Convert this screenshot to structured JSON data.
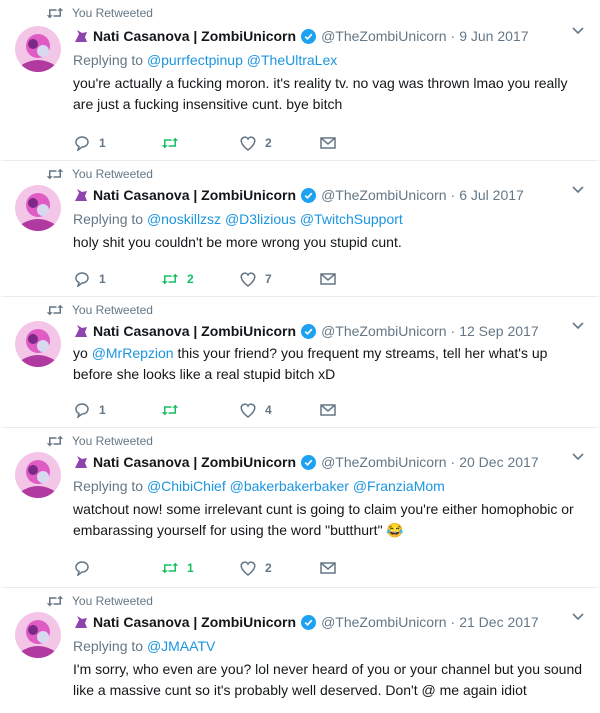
{
  "retweet_label": "You Retweeted",
  "author": {
    "name": "Nati Casanova | ZombiUnicorn",
    "handle": "@TheZombiUnicorn"
  },
  "dot": "·",
  "replying_prefix": "Replying to",
  "colors": {
    "link": "#1b95e0",
    "retweet_green": "#17bf63",
    "muted": "#657786",
    "verified": "#1da1f2"
  },
  "tweets": [
    {
      "date": "9 Jun 2017",
      "reply_to": [
        "@purrfectpinup",
        "@TheUltraLex"
      ],
      "text": "you're actually a fucking moron. it's reality tv. no vag was thrown lmao you really are just a fucking insensitive cunt. bye bitch",
      "replies": "1",
      "retweets": "",
      "likes": "2"
    },
    {
      "date": "6 Jul 2017",
      "reply_to": [
        "@noskillzsz",
        "@D3lizious",
        "@TwitchSupport"
      ],
      "text": "holy shit you couldn't be more wrong you stupid cunt.",
      "replies": "1",
      "retweets": "2",
      "likes": "7"
    },
    {
      "date": "12 Sep 2017",
      "reply_to": [],
      "text_parts": [
        "yo ",
        "@MrRepzion",
        " this your friend? you frequent my streams, tell her what's up before she looks like a real stupid bitch xD"
      ],
      "replies": "1",
      "retweets": "",
      "likes": "4"
    },
    {
      "date": "20 Dec 2017",
      "reply_to": [
        "@ChibiChief",
        "@bakerbakerbaker",
        "@FranziaMom"
      ],
      "text": "watchout now! some irrelevant cunt is going to claim you're either homophobic or embarassing yourself for using the word \"butthurt\" 😂",
      "replies": "",
      "retweets": "1",
      "likes": "2"
    },
    {
      "date": "21 Dec 2017",
      "reply_to": [
        "@JMAATV"
      ],
      "text": "I'm sorry, who even are you? lol never heard of you or your channel but you sound like a massive cunt so it's probably well deserved. Don't @ me again idiot",
      "replies": "",
      "retweets": "",
      "likes": ""
    }
  ]
}
